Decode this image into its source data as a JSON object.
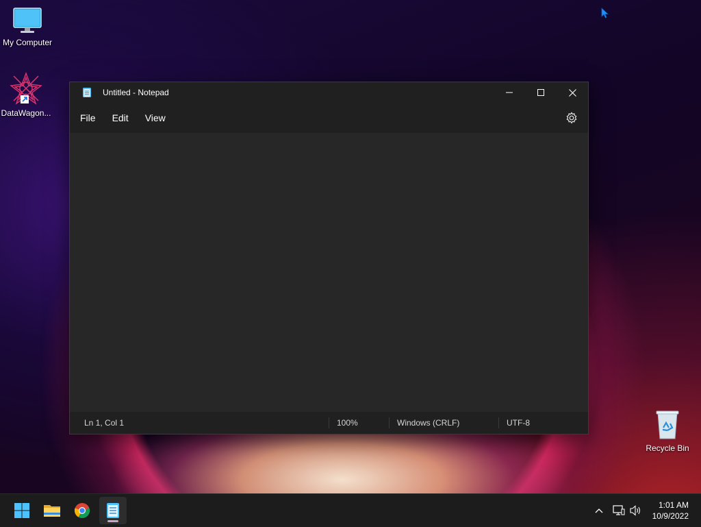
{
  "desktop": {
    "icons": [
      {
        "label": "My Computer",
        "icon": "monitor-icon"
      },
      {
        "label": "DataWagon...",
        "icon": "datawagon-icon"
      },
      {
        "label": "Recycle Bin",
        "icon": "recycle-bin-icon"
      }
    ]
  },
  "window": {
    "title": "Untitled - Notepad",
    "menu": [
      "File",
      "Edit",
      "View"
    ],
    "editor_text": "",
    "status": {
      "position": "Ln 1, Col 1",
      "zoom": "100%",
      "line_endings": "Windows (CRLF)",
      "encoding": "UTF-8"
    }
  },
  "taskbar": {
    "apps": [
      "start-icon",
      "file-explorer-icon",
      "chrome-icon",
      "notepad-icon"
    ],
    "clock": {
      "time": "1:01 AM",
      "date": "10/9/2022"
    }
  },
  "colors": {
    "window_bg": "#272727",
    "titlebar_bg": "#202020",
    "taskbar_bg": "#1c1c1c",
    "accent": "#4cc2ff"
  }
}
